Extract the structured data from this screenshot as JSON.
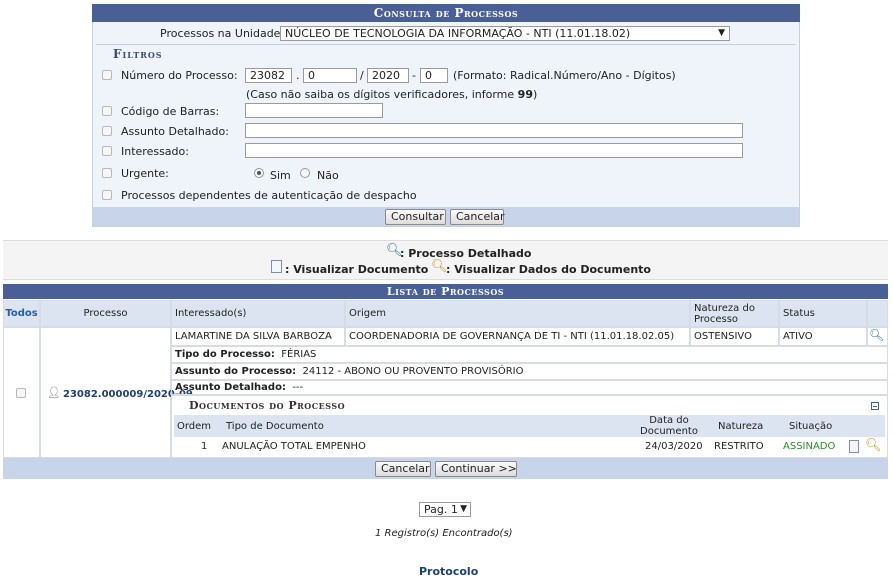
{
  "consulta": {
    "title": "Consulta de Processos",
    "unidade_label": "Processos na Unidade:",
    "unidade_value": "NÚCLEO DE TECNOLOGIA DA INFORMAÇÃO - NTI (11.01.18.02)",
    "filtros_title": "Filtros",
    "numero_label": "Número do Processo:",
    "numero_radical": "23082",
    "numero_numero": "0",
    "numero_ano": "2020",
    "numero_digitos": "0",
    "sep_dot": ".",
    "sep_slash": "/",
    "sep_dash": "-",
    "formato_hint": "(Formato: Radical.Número/Ano - Dígitos)",
    "digitos_hint_prefix": "(Caso não saiba os dígitos verificadores, informe ",
    "digitos_hint_bold": "99",
    "digitos_hint_suffix": ")",
    "codigo_label": "Código de Barras:",
    "assunto_label": "Assunto Detalhado:",
    "interessado_label": "Interessado:",
    "urgente_label": "Urgente:",
    "sim_label": "Sim",
    "nao_label": "Não",
    "dependentes_label": "Processos dependentes de autenticação de despacho",
    "consultar_btn": "Consultar",
    "cancelar_btn": "Cancelar"
  },
  "legend": {
    "detalhado": ": Processo Detalhado",
    "visualizar_doc": ": Visualizar Documento",
    "visualizar_dados": ": Visualizar Dados do Documento"
  },
  "lista": {
    "title": "Lista de Processos",
    "headers": {
      "todos": "Todos",
      "processo": "Processo",
      "interessados": "Interessado(s)",
      "origem": "Origem",
      "natureza_l1": "Natureza do",
      "natureza_l2": "Processo",
      "status": "Status"
    },
    "row": {
      "processo": "23082.000009/2020-09",
      "interessado": "LAMARTINE DA SILVA BARBOZA",
      "origem": "COORDENADORIA DE GOVERNANÇA DE TI - NTI (11.01.18.02.05)",
      "natureza": "OSTENSIVO",
      "status": "ATIVO",
      "tipo_label": "Tipo do Processo:",
      "tipo_value": "FÉRIAS",
      "assunto_label": "Assunto do Processo:",
      "assunto_value": "24112 - ABONO OU PROVENTO PROVISÓRIO",
      "assunto_det_label": "Assunto Detalhado:",
      "assunto_det_value": "---"
    },
    "documentos": {
      "title": "Documentos do Processo",
      "headers": {
        "ordem": "Ordem",
        "tipo": "Tipo de Documento",
        "data_l1": "Data do",
        "data_l2": "Documento",
        "natureza": "Natureza",
        "situacao": "Situação"
      },
      "row": {
        "ordem": "1",
        "tipo": "ANULAÇÃO TOTAL EMPENHO",
        "data": "24/03/2020",
        "natureza": "RESTRITO",
        "situacao": "ASSINADO"
      }
    },
    "cancelar_btn": "Cancelar",
    "continuar_btn": "Continuar >>"
  },
  "pagination": {
    "page_label": "Pag. 1",
    "registros": "1 Registro(s) Encontrado(s)"
  },
  "footer": {
    "protocolo": "Protocolo"
  },
  "colors": {
    "header_blue": "#4a5f96",
    "link_blue": "#1d3f7a",
    "assinado_green": "#2d8a2d"
  }
}
